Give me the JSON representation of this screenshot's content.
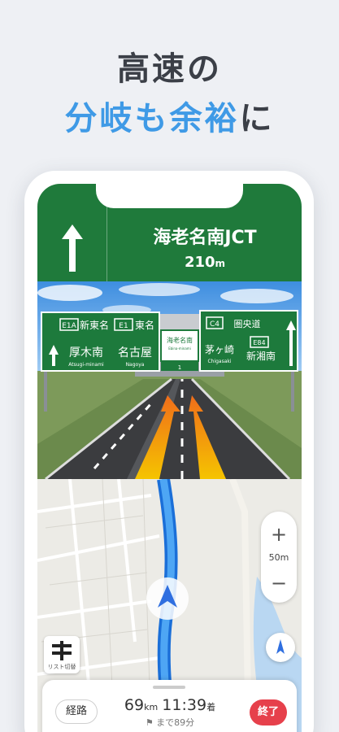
{
  "headline": {
    "line1": "高速の",
    "line2_blue": "分岐も余裕",
    "line2_dark": "に"
  },
  "guidance": {
    "junction": "海老名南JCT",
    "distance_value": "210",
    "distance_unit": "m"
  },
  "signs": {
    "left": {
      "route_code": "E1A",
      "route_name": "新東名",
      "place": "厚木南",
      "place_romaji": "Atsugi-minami"
    },
    "middle": {
      "route_code": "E1",
      "route_name": "東名",
      "place": "名古屋",
      "place_romaji": "Nagoya"
    },
    "center": {
      "name": "海老名南",
      "sub": "Ebina-minami",
      "number": "1"
    },
    "right": {
      "route_code": "C4",
      "route_name": "圏央道",
      "place": "茅ヶ崎",
      "place_romaji": "Chigasaki",
      "route_code2": "E84",
      "place2": "新湘南"
    }
  },
  "map": {
    "zoom_in": "+",
    "zoom_out": "−",
    "scale": "50m",
    "list_switch_label": "リスト切替"
  },
  "bottom_bar": {
    "route_button": "経路",
    "distance": "69",
    "distance_unit": "km",
    "arrival_time": "11:39",
    "arrival_suffix": "着",
    "remaining": "まで89分",
    "end_button": "終了"
  },
  "colors": {
    "guide_green": "#1f7a3b",
    "accent_blue": "#3f9ae6",
    "end_red": "#e6404b"
  }
}
